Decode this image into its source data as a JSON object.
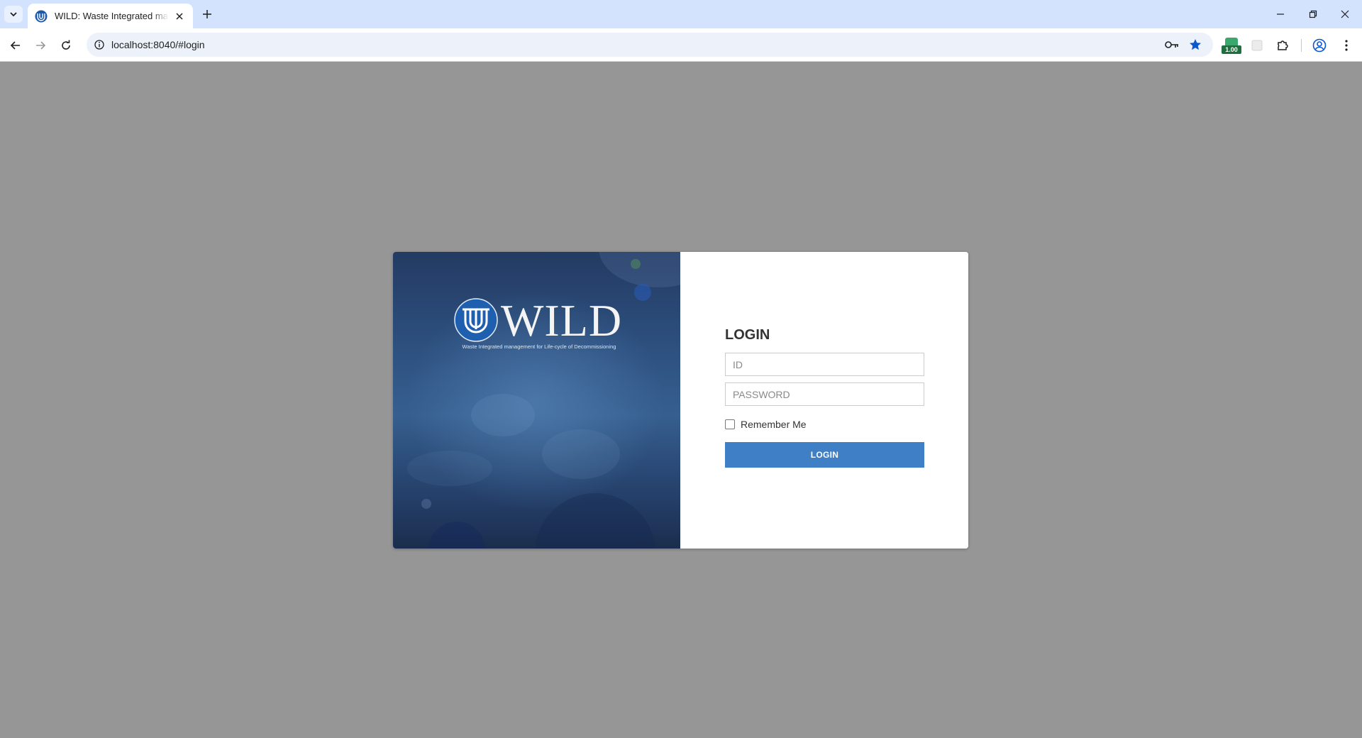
{
  "browser": {
    "tab_title": "WILD: Waste Integrated management for Life-cycle of Decommissioning",
    "url": "localhost:8040/#login",
    "extension_badge": "1.00"
  },
  "hero": {
    "brand": "WILD",
    "tagline": "Waste Integrated management for Life-cycle of Decommissioning"
  },
  "login": {
    "title": "LOGIN",
    "id_placeholder": "ID",
    "password_placeholder": "PASSWORD",
    "remember_label": "Remember Me",
    "button_label": "LOGIN"
  },
  "colors": {
    "browser_tabstrip": "#d3e3fd",
    "page_background": "#969696",
    "login_button": "#3e7fc6",
    "hero_dark": "#1b2d4e"
  }
}
